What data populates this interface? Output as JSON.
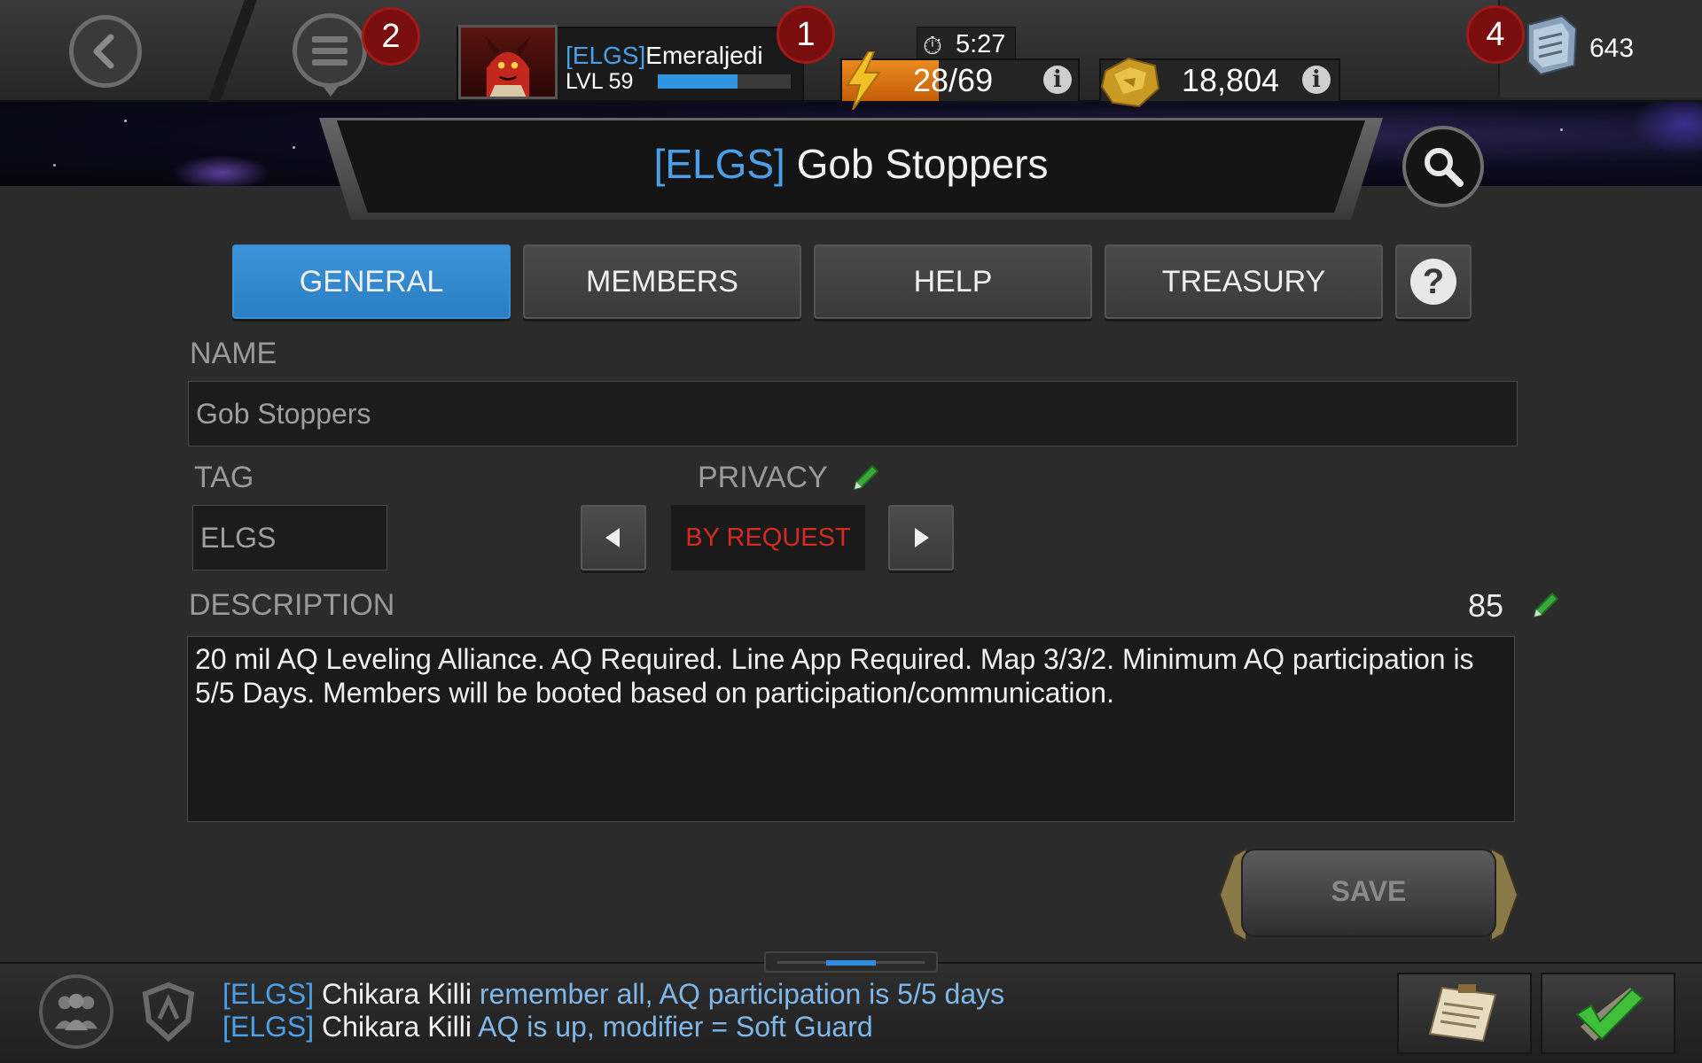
{
  "header": {
    "menu_badge": "2",
    "profile_badge": "1",
    "units_badge": "4",
    "profile": {
      "tag": "[ELGS]",
      "name": "Emeraljedi",
      "level": "LVL 59",
      "xp_fraction": 0.6
    },
    "timer": "5:27",
    "energy": {
      "value": "28/69",
      "fraction": 0.41
    },
    "gold": "18,804",
    "units": "643"
  },
  "title": {
    "tag": "[ELGS]",
    "name": "Gob Stoppers"
  },
  "tabs": [
    {
      "label": "GENERAL",
      "active": true
    },
    {
      "label": "MEMBERS",
      "active": false
    },
    {
      "label": "HELP",
      "active": false
    },
    {
      "label": "TREASURY",
      "active": false
    }
  ],
  "form": {
    "name_label": "NAME",
    "name_value": "Gob Stoppers",
    "tag_label": "TAG",
    "tag_value": "ELGS",
    "privacy_label": "PRIVACY",
    "privacy_value": "BY REQUEST",
    "description_label": "DESCRIPTION",
    "description_count": "85",
    "description_text": "20 mil AQ Leveling Alliance. AQ Required. Line App Required. Map 3/3/2. Minimum AQ participation is 5/5 Days. Members will be booted based on participation/communication.",
    "save_label": "SAVE"
  },
  "chat": [
    {
      "tag": "[ELGS]",
      "who": "Chikara Killi",
      "msg": "remember all, AQ participation is 5/5 days"
    },
    {
      "tag": "[ELGS]",
      "who": "Chikara Killi",
      "msg": "AQ is up, modifier = Soft Guard"
    }
  ],
  "colors": {
    "accent_blue": "#2f8de0",
    "tag_blue": "#4aa0e8",
    "privacy_red": "#d42a22",
    "energy_orange": "#ea8a1f"
  }
}
